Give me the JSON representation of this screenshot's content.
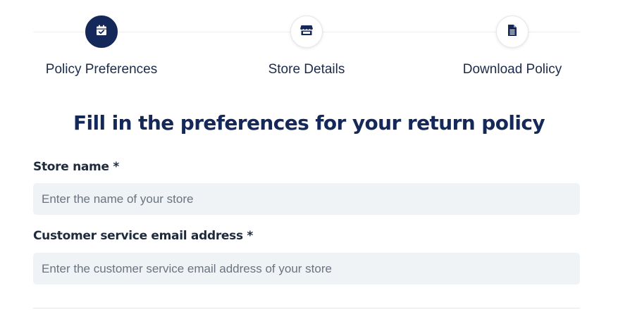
{
  "stepper": {
    "steps": [
      {
        "label": "Policy Preferences",
        "icon": "calendar-check-icon",
        "active": true
      },
      {
        "label": "Store Details",
        "icon": "storefront-icon",
        "active": false
      },
      {
        "label": "Download Policy",
        "icon": "document-icon",
        "active": false
      }
    ]
  },
  "form": {
    "heading": "Fill in the preferences for your return policy",
    "store_name": {
      "label": "Store name *",
      "placeholder": "Enter the name of your store",
      "value": ""
    },
    "email": {
      "label": "Customer service email address *",
      "placeholder": "Enter the customer service email address of your store",
      "value": ""
    }
  },
  "colors": {
    "primary": "#14285a",
    "input_bg": "#f0f3f6",
    "text": "#1c2b4a"
  }
}
